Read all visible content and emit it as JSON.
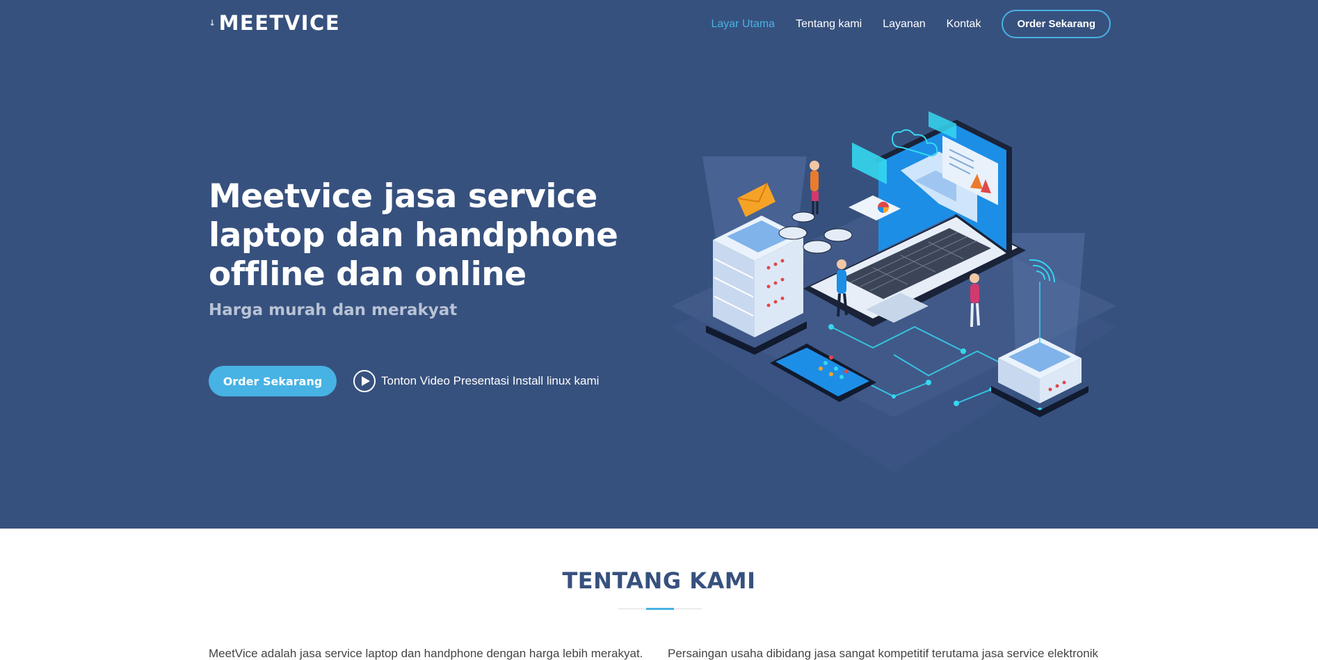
{
  "brand": {
    "name": "MEETVICE",
    "mark_icon": "arrow-down-icon"
  },
  "nav": {
    "items": [
      {
        "label": "Layar Utama",
        "active": true
      },
      {
        "label": "Tentang kami",
        "active": false
      },
      {
        "label": "Layanan",
        "active": false
      },
      {
        "label": "Kontak",
        "active": false
      }
    ],
    "cta_label": "Order Sekarang"
  },
  "hero": {
    "title": "Meetvice jasa service laptop dan handphone offline dan online",
    "subtitle": "Harga murah dan merakyat",
    "button_label": "Order Sekarang",
    "video_label": "Tonton Video Presentasi Install linux kami",
    "video_icon": "play-icon",
    "illustration": "isometric-laptop-servers-illustration"
  },
  "about": {
    "title": "TENTANG KAMI",
    "col1": "MeetVice adalah jasa service laptop dan handphone dengan harga lebih merakyat.",
    "col2": "Persaingan usaha dibidang jasa sangat kompetitif terutama jasa service elektronik"
  },
  "colors": {
    "hero_bg": "#37517e",
    "accent": "#47b2e4",
    "heading": "#37517e",
    "body_text": "#444444"
  }
}
